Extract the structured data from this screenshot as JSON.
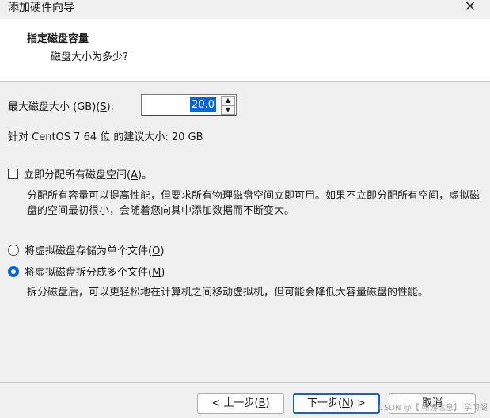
{
  "window": {
    "title": "添加硬件向导",
    "close_glyph": "✕"
  },
  "header": {
    "title": "指定磁盘容量",
    "subtitle": "磁盘大小为多少?"
  },
  "size": {
    "label_prefix": "最大磁盘大小 (GB)(",
    "label_key": "S",
    "label_suffix": "):",
    "value": "20.0"
  },
  "recommend": "针对 CentOS 7 64 位 的建议大小: 20 GB",
  "allocate": {
    "label_prefix": "立即分配所有磁盘空间(",
    "label_key": "A",
    "label_suffix": ")。",
    "checked": false,
    "description": "分配所有容量可以提高性能，但要求所有物理磁盘空间立即可用。如果不立即分配所有空间，虚拟磁盘的空间最初很小，会随着您向其中添加数据而不断变大。"
  },
  "storage_options": [
    {
      "label_prefix": "将虚拟磁盘存储为单个文件(",
      "label_key": "O",
      "label_suffix": ")",
      "checked": false
    },
    {
      "label_prefix": "将虚拟磁盘拆分成多个文件(",
      "label_key": "M",
      "label_suffix": ")",
      "checked": true
    }
  ],
  "split_description": "拆分磁盘后，可以更轻松地在计算机之间移动虚拟机，但可能会降低大容量磁盘的性能。",
  "buttons": {
    "back": {
      "prefix": "< 上一步(",
      "key": "B",
      "suffix": ")"
    },
    "next": {
      "prefix": "下一步(",
      "key": "N",
      "suffix": ") >"
    },
    "cancel": "取消"
  },
  "watermark": "CSDN @【 畅游信息】 学习阁",
  "colors": {
    "accent": "#0a64d6",
    "header_bg": "#ffffff",
    "body_bg": "#f0f0f0"
  }
}
